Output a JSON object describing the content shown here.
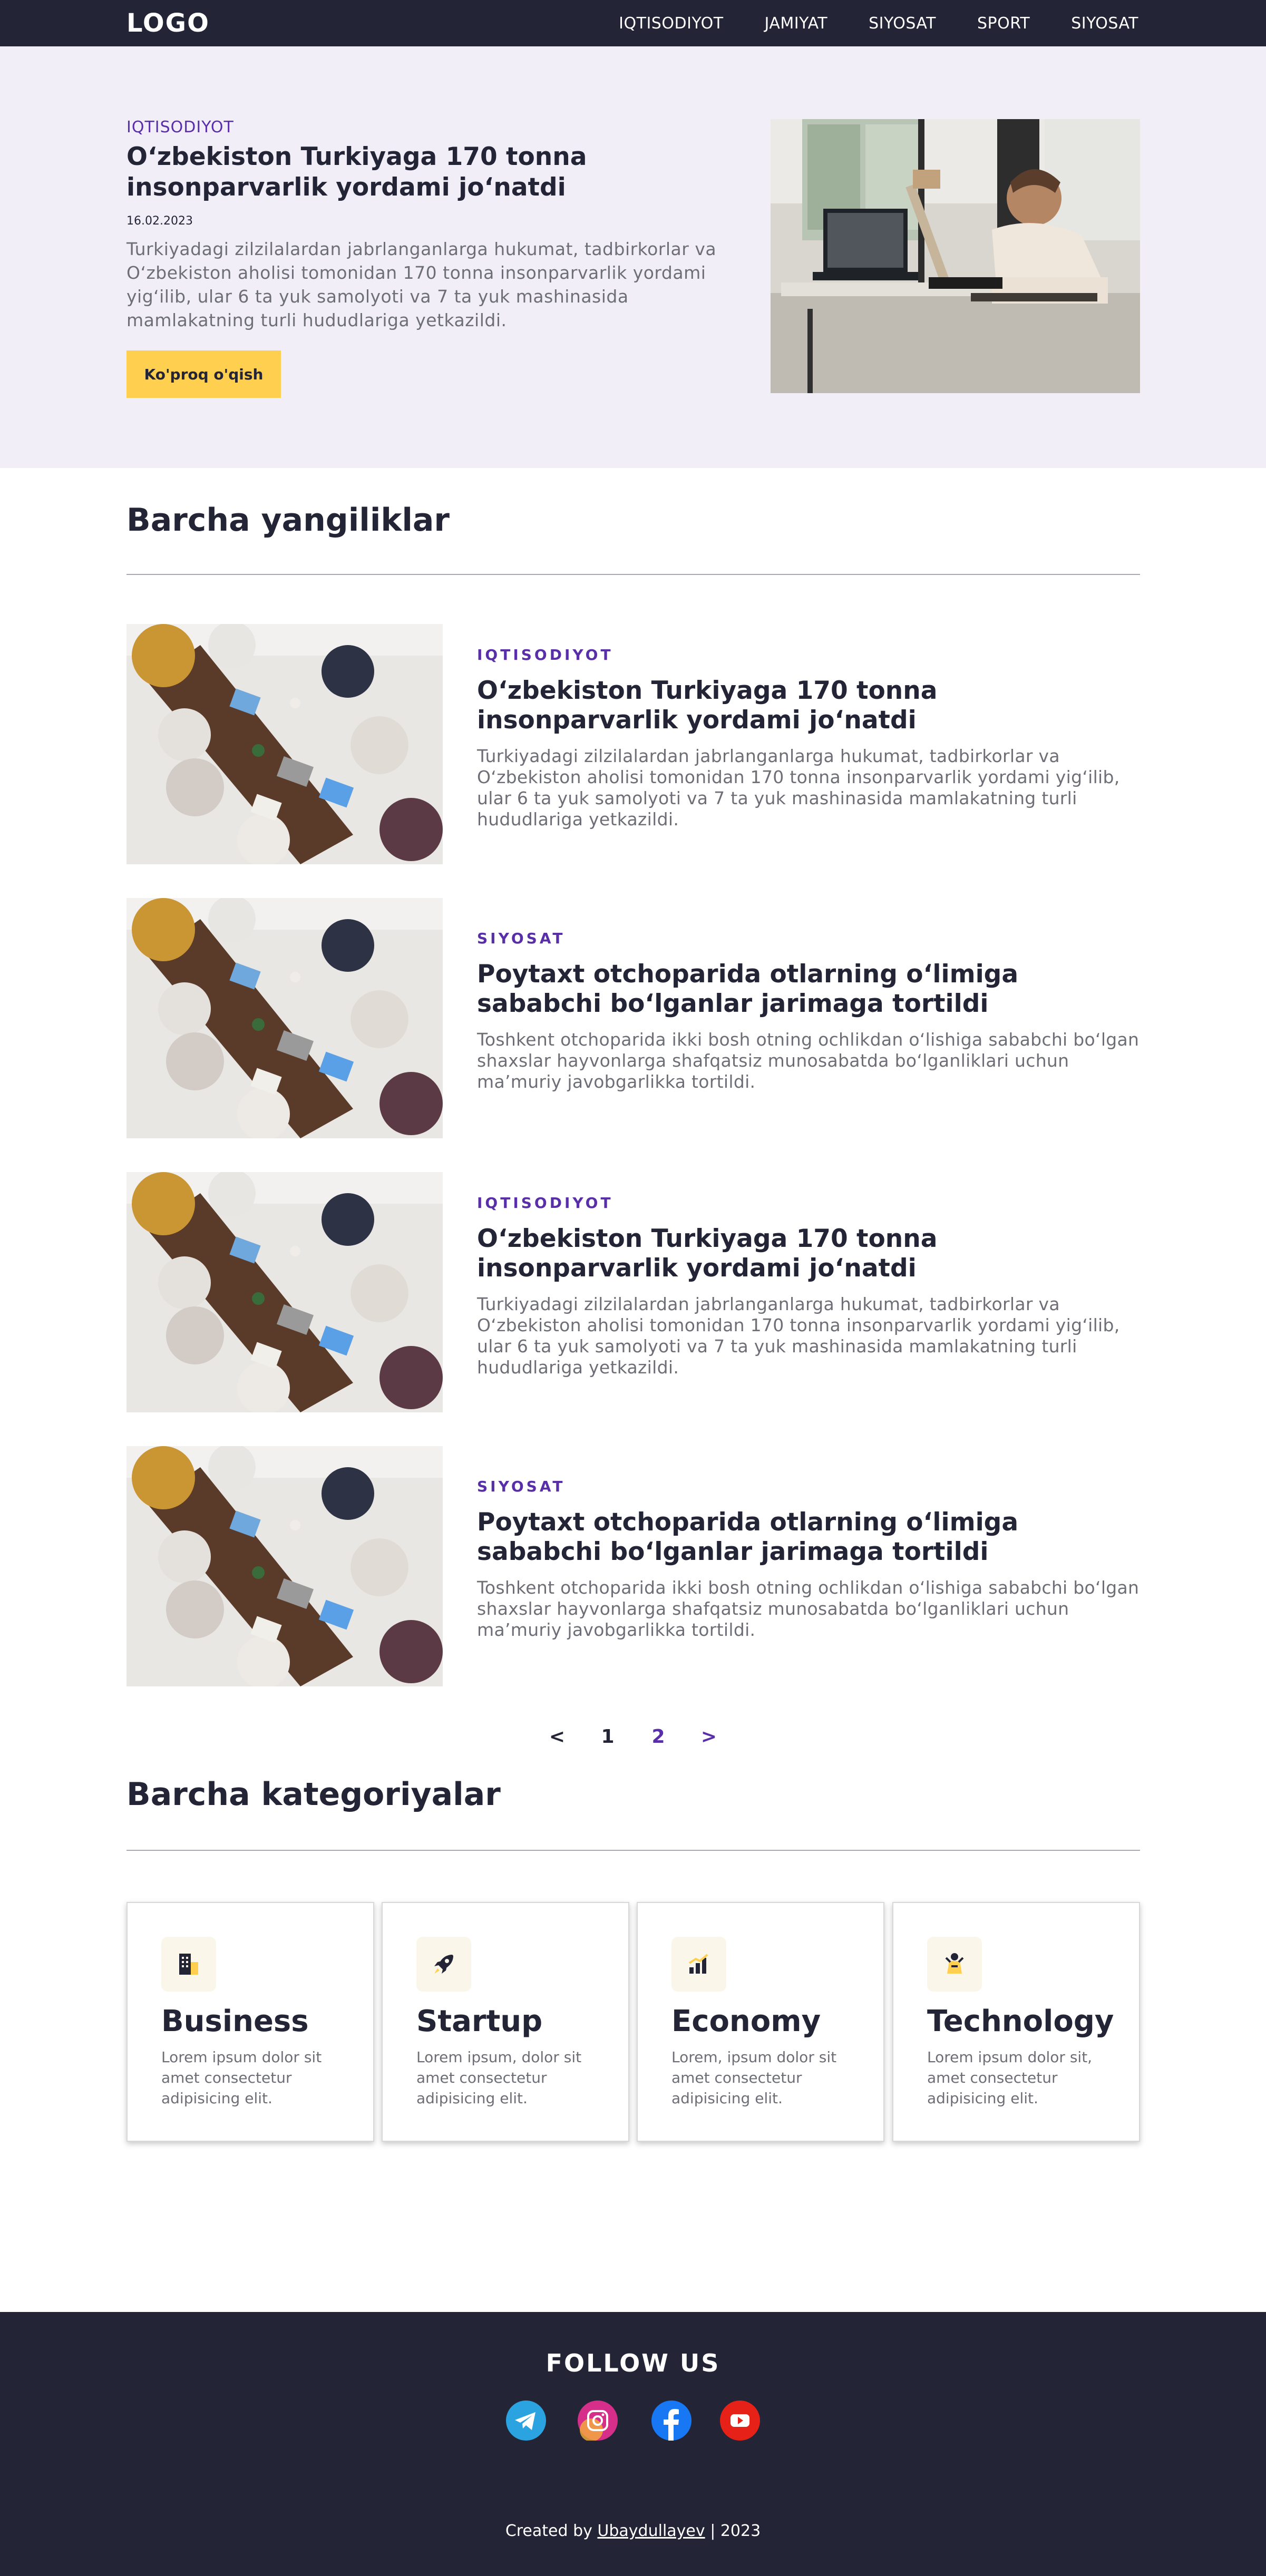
{
  "navbar": {
    "logo": "LOGO",
    "links": [
      "IQTISODIYOT",
      "JAMIYAT",
      "SIYOSAT",
      "SPORT",
      "SIYOSAT"
    ]
  },
  "hero": {
    "category": "IQTISODIYOT",
    "title": "O‘zbekiston Turkiyaga 170 tonna insonparvarlik yordami jo‘natdi",
    "date": "16.02.2023",
    "description": "Turkiyadagi zilzilalardan jabrlanganlarga hukumat, tadbirkorlar va O‘zbekiston aholisi tomonidan 170 tonna insonparvarlik yordami yig‘ilib, ular 6 ta yuk samolyoti va 7 ta yuk mashinasida mamlakatning turli hududlariga yetkazildi.",
    "button_label": "Ko'proq o'qish"
  },
  "news_section": {
    "title": "Barcha yangiliklar",
    "items": [
      {
        "category": "IQTISODIYOT",
        "title": "O‘zbekiston Turkiyaga 170 tonna insonparvarlik yordami jo‘natdi",
        "description": "Turkiyadagi zilzilalardan jabrlanganlarga hukumat, tadbirkorlar va O‘zbekiston aholisi tomonidan 170 tonna insonparvarlik yordami yig‘ilib, ular 6 ta yuk samolyoti va 7 ta yuk mashinasida mamlakatning turli hududlariga yetkazildi."
      },
      {
        "category": "SIYOSAT",
        "title": "Poytaxt otchoparida otlarning o‘limiga sababchi bo‘lganlar jarimaga tortildi",
        "description": "Toshkent otchoparida ikki bosh otning ochlikdan o‘lishiga sababchi bo‘lgan shaxslar hayvonlarga shafqatsiz munosabatda bo‘lganliklari uchun ma’muriy javobgarlikka tortildi."
      },
      {
        "category": "IQTISODIYOT",
        "title": "O‘zbekiston Turkiyaga 170 tonna insonparvarlik yordami jo‘natdi",
        "description": "Turkiyadagi zilzilalardan jabrlanganlarga hukumat, tadbirkorlar va O‘zbekiston aholisi tomonidan 170 tonna insonparvarlik yordami yig‘ilib, ular 6 ta yuk samolyoti va 7 ta yuk mashinasida mamlakatning turli hududlariga yetkazildi."
      },
      {
        "category": "SIYOSAT",
        "title": "Poytaxt otchoparida otlarning o‘limiga sababchi bo‘lganlar jarimaga tortildi",
        "description": "Toshkent otchoparida ikki bosh otning ochlikdan o‘lishiga sababchi bo‘lgan shaxslar hayvonlarga shafqatsiz munosabatda bo‘lganliklari uchun ma’muriy javobgarlikka tortildi."
      }
    ]
  },
  "pagination": {
    "prev": "<",
    "pages": [
      "1",
      "2"
    ],
    "next": ">",
    "active_page": "2"
  },
  "categories_section": {
    "title": "Barcha kategoriyalar",
    "cards": [
      {
        "icon": "business-icon",
        "title": "Business",
        "description": "Lorem ipsum dolor sit amet consectetur adipisicing elit."
      },
      {
        "icon": "rocket-icon",
        "title": "Startup",
        "description": "Lorem ipsum, dolor sit amet consectetur adipisicing elit."
      },
      {
        "icon": "bar-chart-icon",
        "title": "Economy",
        "description": "Lorem, ipsum dolor sit amet consectetur adipisicing elit."
      },
      {
        "icon": "technology-icon",
        "title": "Technology",
        "description": "Lorem ipsum dolor sit, amet consectetur adipisicing elit."
      }
    ]
  },
  "footer": {
    "follow_title": "FOLLOW US",
    "socials": [
      "telegram-icon",
      "instagram-icon",
      "facebook-icon",
      "youtube-icon"
    ],
    "credit_prefix": "Created by",
    "credit_author": "Ubaydullayev",
    "credit_suffix": "| 2023"
  },
  "colors": {
    "dark": "#232536",
    "accent_purple": "#592ea9",
    "button_yellow": "#ffd050",
    "hero_bg": "#f1eef7",
    "text_gray": "#6d6e76"
  }
}
